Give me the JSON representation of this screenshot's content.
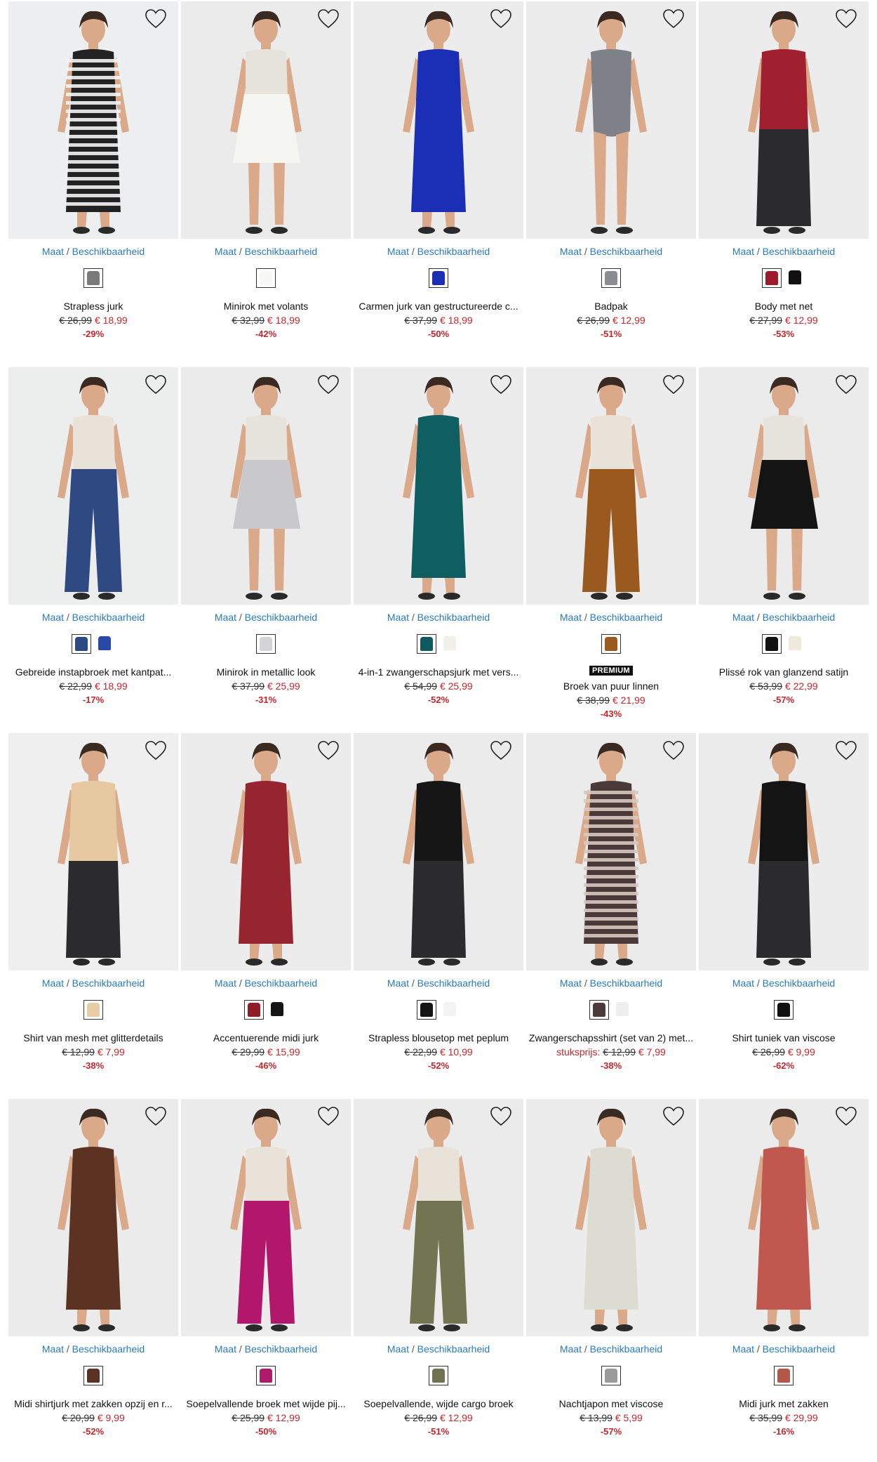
{
  "size_link": {
    "maat": "Maat",
    "sep": " / ",
    "beschik": "Beschikbaarheid"
  },
  "products": [
    {
      "name": "Strapless jurk",
      "old": "€ 26,99",
      "new": "€ 18,99",
      "discount": "-29%",
      "bg": "#eceeef",
      "colors": [
        "#7a7a7a"
      ],
      "figure": "#222222",
      "pattern": "stripe-bw",
      "icon": "heart-icon"
    },
    {
      "name": "Minirok met volants",
      "old": "€ 32,99",
      "new": "€ 18,99",
      "discount": "-42%",
      "bg": "#ebebeb",
      "colors": [
        "#f7f7f5"
      ],
      "figure": "#f5f5f2",
      "pattern": "skirt",
      "icon": "heart-icon"
    },
    {
      "name": "Carmen jurk van gestructureerde c...",
      "old": "€ 37,99",
      "new": "€ 18,99",
      "discount": "-50%",
      "bg": "#ececed",
      "colors": [
        "#1c2fb0"
      ],
      "figure": "#1a2fb5",
      "pattern": "dress",
      "icon": "heart-icon"
    },
    {
      "name": "Badpak",
      "old": "€ 26,99",
      "new": "€ 12,99",
      "discount": "-51%",
      "bg": "#ececec",
      "colors": [
        "#8a8d92"
      ],
      "figure": "#7e8288",
      "pattern": "swim",
      "icon": "heart-icon"
    },
    {
      "name": "Body met net",
      "old": "€ 27,99",
      "new": "€ 12,99",
      "discount": "-53%",
      "bg": "#ececec",
      "colors": [
        "#9b1c2c",
        "#111111"
      ],
      "figure": "#a0202f",
      "pattern": "top",
      "icon": "heart-icon"
    },
    {
      "name": "Gebreide instapbroek met kantpat...",
      "old": "€ 22,99",
      "new": "€ 18,99",
      "discount": "-17%",
      "bg": "#eceeee",
      "colors": [
        "#2d4a86",
        "#2a48a6"
      ],
      "figure": "#2f4a82",
      "pattern": "pants",
      "icon": "heart-icon"
    },
    {
      "name": "Minirok in metallic look",
      "old": "€ 37,99",
      "new": "€ 25,99",
      "discount": "-31%",
      "bg": "#ebebeb",
      "colors": [
        "#d4d4d6"
      ],
      "figure": "#c9c9cc",
      "pattern": "skirt",
      "icon": "heart-icon"
    },
    {
      "name": "4-in-1 zwangerschapsjurk met vers...",
      "old": "€ 54,99",
      "new": "€ 25,99",
      "discount": "-52%",
      "bg": "#ececec",
      "colors": [
        "#0d5a5e",
        "#f2f0ea"
      ],
      "figure": "#0e5e62",
      "pattern": "dress",
      "icon": "heart-icon"
    },
    {
      "name": "Broek van puur linnen",
      "old": "€ 38,99",
      "new": "€ 21,99",
      "discount": "-43%",
      "bg": "#ececec",
      "colors": [
        "#9b5a20"
      ],
      "figure": "#9a5a1f",
      "pattern": "pants",
      "premium": "PREMIUM",
      "icon": "heart-icon"
    },
    {
      "name": "Plissé rok van glanzend satijn",
      "old": "€ 53,99",
      "new": "€ 22,99",
      "discount": "-57%",
      "bg": "#ebebeb",
      "colors": [
        "#121212",
        "#efe9dc"
      ],
      "figure": "#141414",
      "pattern": "skirt",
      "icon": "heart-icon"
    },
    {
      "name": "Shirt van mesh met glitterdetails",
      "old": "€ 12,99",
      "new": "€ 7,99",
      "discount": "-38%",
      "bg": "#efefef",
      "colors": [
        "#e7cda6"
      ],
      "figure": "#e6c9a0",
      "pattern": "top",
      "icon": "heart-icon"
    },
    {
      "name": "Accentuerende midi jurk",
      "old": "€ 29,99",
      "new": "€ 15,99",
      "discount": "-46%",
      "bg": "#ececec",
      "colors": [
        "#8e1d27",
        "#151515"
      ],
      "figure": "#962530",
      "pattern": "dress",
      "icon": "heart-icon"
    },
    {
      "name": "Strapless blousetop met peplum",
      "old": "€ 22,99",
      "new": "€ 10,99",
      "discount": "-52%",
      "bg": "#ebebeb",
      "colors": [
        "#151515",
        "#f3f3f3"
      ],
      "figure": "#161616",
      "pattern": "top",
      "icon": "heart-icon"
    },
    {
      "name": "Zwangerschapsshirt (set van 2) met...",
      "unit": "stuksprijs:",
      "old": "€ 12,99",
      "new": "€ 7,99",
      "discount": "-38%",
      "bg": "#ebebeb",
      "colors": [
        "#4a3b3a",
        "#eeeeee"
      ],
      "figure": "#4a3a39",
      "pattern": "stripe-dark",
      "icon": "heart-icon"
    },
    {
      "name": "Shirt tuniek van viscose",
      "old": "€ 26,99",
      "new": "€ 9,99",
      "discount": "-62%",
      "bg": "#ececec",
      "colors": [
        "#111111"
      ],
      "figure": "#141414",
      "pattern": "top",
      "icon": "heart-icon"
    },
    {
      "name": "Midi shirtjurk met zakken opzij en r...",
      "old": "€ 20,99",
      "new": "€ 9,99",
      "discount": "-52%",
      "bg": "#ebebeb",
      "colors": [
        "#5a3222"
      ],
      "figure": "#5c3322",
      "pattern": "dress",
      "icon": "heart-icon"
    },
    {
      "name": "Soepelvallende broek met wijde pij...",
      "old": "€ 25,99",
      "new": "€ 12,99",
      "discount": "-50%",
      "bg": "#ececec",
      "colors": [
        "#b01a6a"
      ],
      "figure": "#b3176b",
      "pattern": "pants",
      "icon": "heart-icon"
    },
    {
      "name": "Soepelvallende, wijde cargo broek",
      "old": "€ 26,99",
      "new": "€ 12,99",
      "discount": "-51%",
      "bg": "#ebebeb",
      "colors": [
        "#6f7352"
      ],
      "figure": "#727552",
      "pattern": "pants",
      "icon": "heart-icon"
    },
    {
      "name": "Nachtjapon met viscose",
      "old": "€ 13,99",
      "new": "€ 5,99",
      "discount": "-57%",
      "bg": "#ececec",
      "colors": [
        "#9a9a9a"
      ],
      "figure": "#dcdcd2",
      "pattern": "dress",
      "icon": "heart-icon"
    },
    {
      "name": "Midi jurk met zakken",
      "old": "€ 35,99",
      "new": "€ 29,99",
      "discount": "-16%",
      "bg": "#ebebeb",
      "colors": [
        "#b1584a"
      ],
      "figure": "#c0584f",
      "pattern": "dress",
      "icon": "heart-icon"
    }
  ]
}
